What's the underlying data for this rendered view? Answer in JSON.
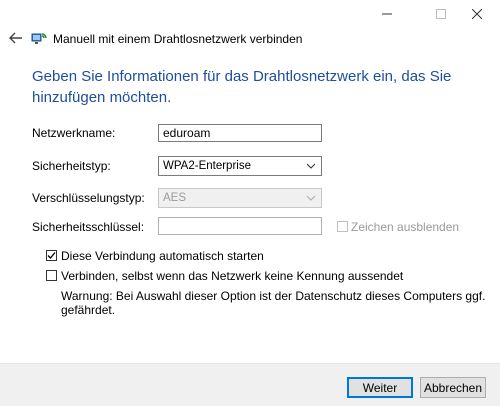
{
  "window": {
    "title": "Manuell mit einem Drahtlosnetzwerk verbinden",
    "controls": {
      "minimize": "—",
      "maximize": "☐",
      "close": "✕"
    }
  },
  "heading": "Geben Sie Informationen für das Drahtlosnetzwerk ein, das Sie hinzufügen möchten.",
  "form": {
    "network_name": {
      "label": "Netzwerkname:",
      "value": "eduroam"
    },
    "security_type": {
      "label": "Sicherheitstyp:",
      "value": "WPA2-Enterprise"
    },
    "encryption_type": {
      "label": "Verschlüsselungstyp:",
      "value": "AES"
    },
    "security_key": {
      "label": "Sicherheitsschlüssel:",
      "value": "",
      "hide_chars_label": "Zeichen ausblenden"
    },
    "auto_connect": {
      "label": "Diese Verbindung automatisch starten",
      "checked": true
    },
    "connect_hidden": {
      "label": "Verbinden, selbst wenn das Netzwerk keine Kennung aussendet",
      "checked": false
    },
    "warning": "Warnung: Bei Auswahl dieser Option ist der Datenschutz dieses Computers ggf. gefährdet."
  },
  "buttons": {
    "next": "Weiter",
    "cancel": "Abbrechen"
  },
  "colors": {
    "heading": "#1e4d9e",
    "accent": "#0078d7",
    "footer": "#f0f0f0"
  }
}
